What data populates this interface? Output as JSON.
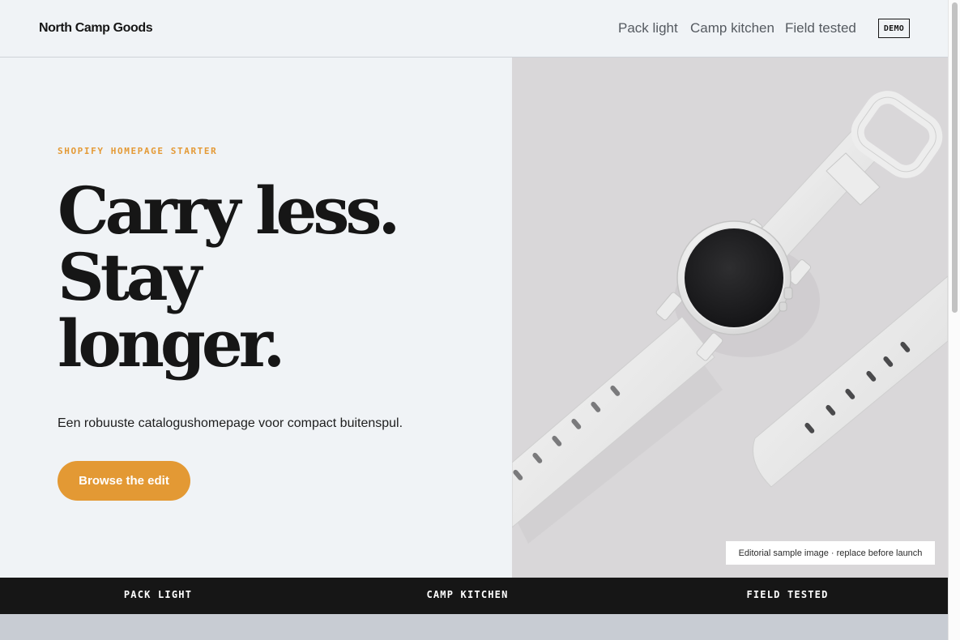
{
  "header": {
    "brand": "North Camp Goods",
    "nav": [
      {
        "label": "Pack light"
      },
      {
        "label": "Camp kitchen"
      },
      {
        "label": "Field tested"
      }
    ],
    "badge": "DEMO"
  },
  "hero": {
    "eyebrow": "SHOPIFY HOMEPAGE STARTER",
    "headline": [
      "Carry less.",
      "Stay",
      "longer."
    ],
    "tagline": "Een robuuste catalogushomepage voor compact buitenspul.",
    "cta_label": "Browse the edit",
    "image": {
      "subject": "smartwatch-icon",
      "caption": "Editorial sample image · replace before launch"
    }
  },
  "categories": [
    "PACK LIGHT",
    "CAMP KITCHEN",
    "FIELD TESTED"
  ],
  "colors": {
    "background": "#f0f3f6",
    "accent": "#e39934",
    "ink": "#161616",
    "image_bg": "#d9d7d9",
    "strip_below": "#c8ccd3"
  }
}
